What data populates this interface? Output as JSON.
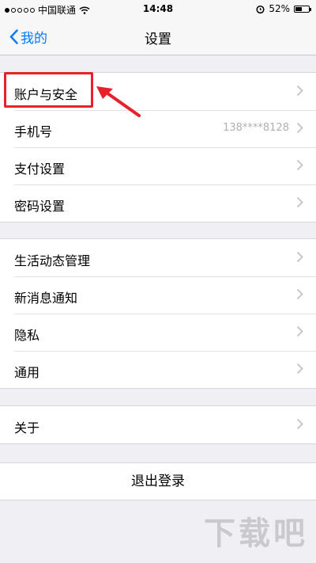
{
  "status_bar": {
    "carrier": "中国联通",
    "time": "14:48",
    "battery": "52%",
    "battery_level": 0.52
  },
  "nav": {
    "back_label": "我的",
    "title": "设置"
  },
  "groups": [
    {
      "items": [
        {
          "label": "账户与安全",
          "value": ""
        },
        {
          "label": "手机号",
          "value": "138****8128"
        },
        {
          "label": "支付设置",
          "value": ""
        },
        {
          "label": "密码设置",
          "value": ""
        }
      ]
    },
    {
      "items": [
        {
          "label": "生活动态管理",
          "value": ""
        },
        {
          "label": "新消息通知",
          "value": ""
        },
        {
          "label": "隐私",
          "value": ""
        },
        {
          "label": "通用",
          "value": ""
        }
      ]
    },
    {
      "items": [
        {
          "label": "关于",
          "value": ""
        }
      ]
    }
  ],
  "logout_label": "退出登录",
  "watermark": "下载吧",
  "colors": {
    "accent": "#007aff",
    "highlight": "#e8202a",
    "background": "#efeff4"
  }
}
